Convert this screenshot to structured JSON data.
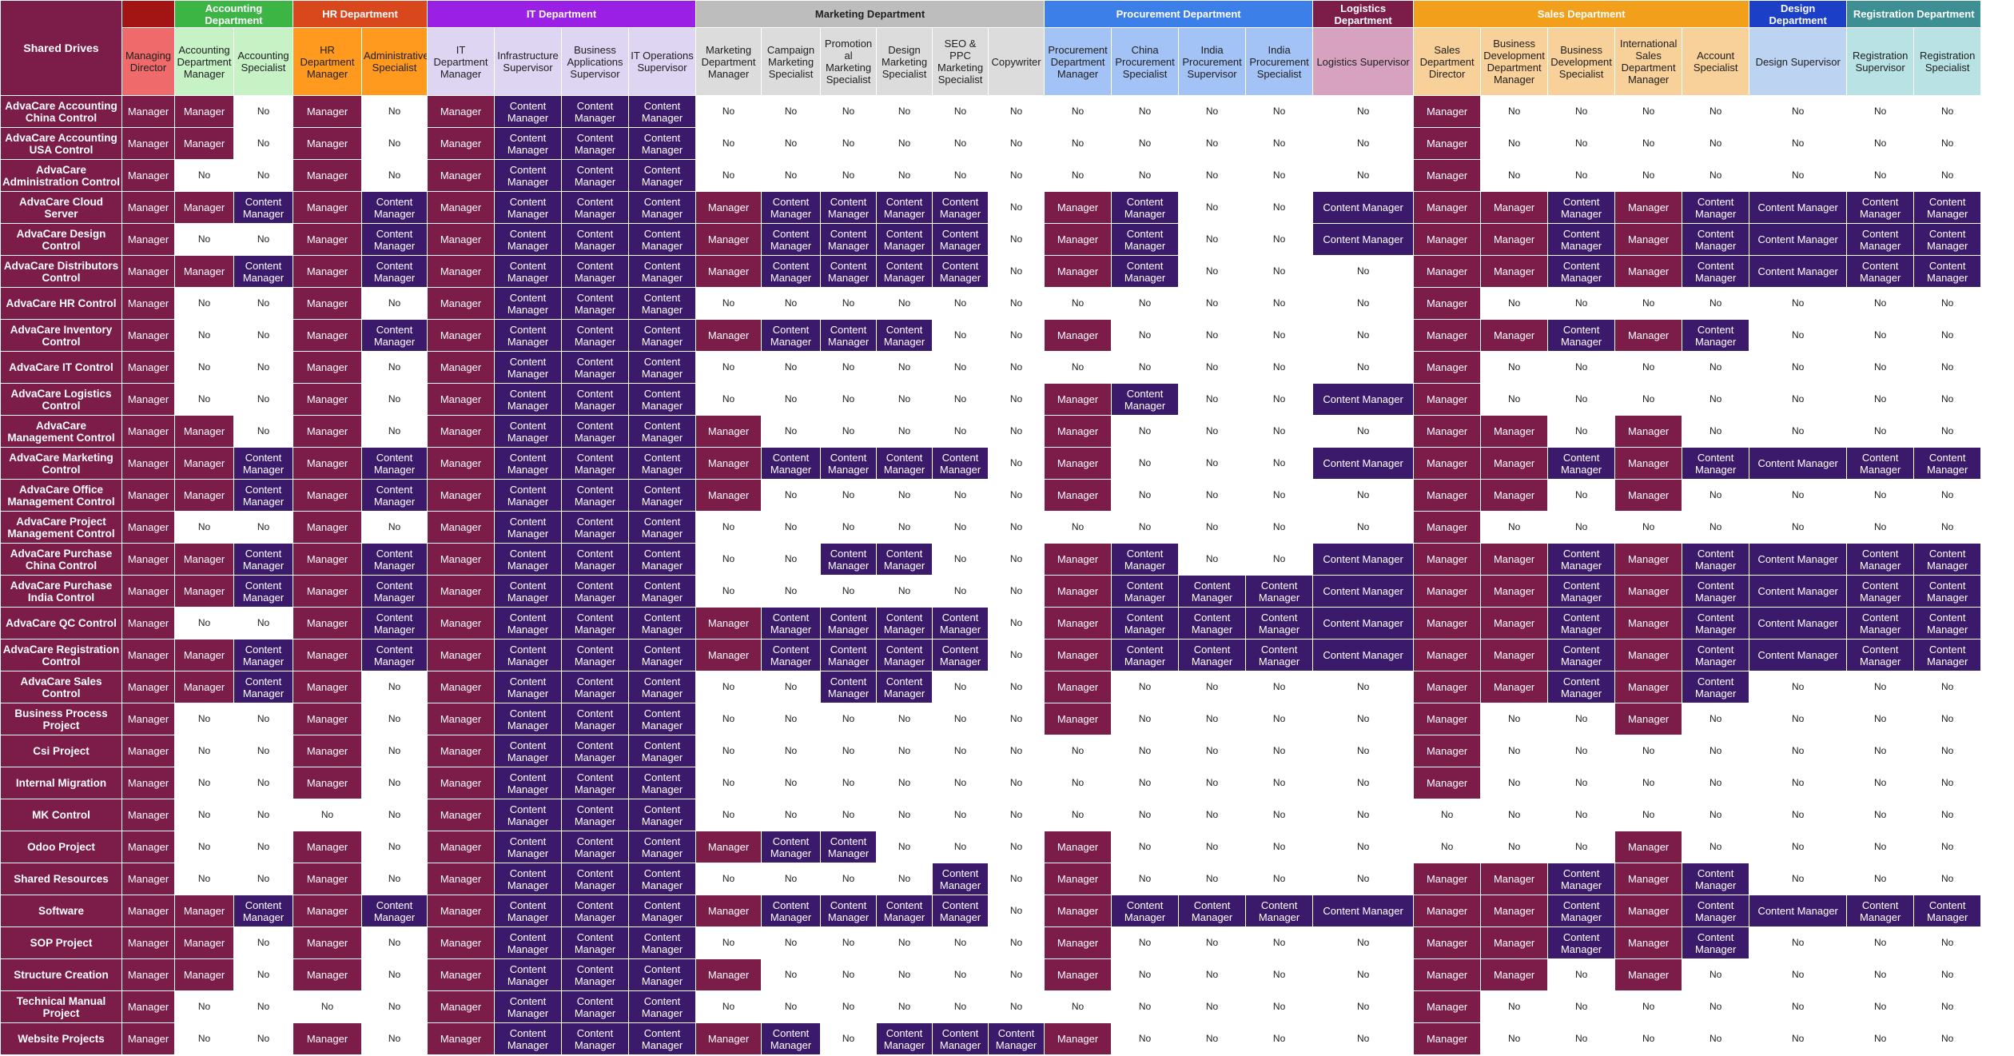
{
  "corner_label": "Shared Drives",
  "colors": {
    "manager": "#7b1c49",
    "content_manager": "#3b1a6b",
    "none": "#ffffff"
  },
  "departments": [
    {
      "name": "",
      "span": 1,
      "color": "#a31515",
      "role_color": "#ef6a6a"
    },
    {
      "name": "Accounting Department",
      "span": 2,
      "color": "#3cb545",
      "role_color": "#c6f2c6"
    },
    {
      "name": "HR Department",
      "span": 2,
      "color": "#d9471c",
      "role_color": "#ff9a1f"
    },
    {
      "name": "IT Department",
      "span": 4,
      "color": "#9a20e6",
      "role_color": "#ddd5f2"
    },
    {
      "name": "Marketing Department",
      "span": 6,
      "color": "#bdbdbd",
      "role_color": "#dcdcdc",
      "dark": true
    },
    {
      "name": "Procurement Department",
      "span": 4,
      "color": "#3d7fe8",
      "role_color": "#a3c2f5"
    },
    {
      "name": "Logistics Department",
      "span": 1,
      "color": "#7b1c49",
      "role_color": "#d6a2c0"
    },
    {
      "name": "Sales Department",
      "span": 5,
      "color": "#f2a01c",
      "role_color": "#f8d09a"
    },
    {
      "name": "Design Department",
      "span": 1,
      "color": "#1c3fc7",
      "role_color": "#bcd4f2"
    },
    {
      "name": "Registration Department",
      "span": 2,
      "color": "#3d8f93",
      "role_color": "#b8e2e4"
    }
  ],
  "roles": [
    "Managing Director",
    "Accounting Department Manager",
    "Accounting Specialist",
    "HR Department Manager",
    "Administrative Specialist",
    "IT Department Manager",
    "Infrastructure Supervisor",
    "Business Applications Supervisor",
    "IT Operations Supervisor",
    "Marketing Department Manager",
    "Campaign Marketing Specialist",
    "Promotion al Marketing Specialist",
    "Design Marketing Specialist",
    "SEO & PPC Marketing Specialist",
    "Copywriter",
    "Procurement Department Manager",
    "China Procurement Specialist",
    "India Procurement Supervisor",
    "India Procurement Specialist",
    "Logistics Supervisor",
    "Sales Department Director",
    "Business Development Department Manager",
    "Business Development Specialist",
    "International Sales Department Manager",
    "Account Specialist",
    "Design Supervisor",
    "Registration Supervisor",
    "Registration Specialist"
  ],
  "labels": {
    "M": "Manager",
    "C": "Content Manager",
    "N": "No"
  },
  "drives": [
    {
      "name": "AdvaCare Accounting China Control",
      "access": "MMNMNMCCCNNNNNNNNNNNMNNNNNNN"
    },
    {
      "name": "AdvaCare Accounting USA Control",
      "access": "MMNMNMCCCNNNNNNNNNNNMNNNNNNN"
    },
    {
      "name": "AdvaCare Administration Control",
      "access": "MNNMNMCCCNNNNNNNNNNNMNNNNNNN"
    },
    {
      "name": "AdvaCare Cloud Server",
      "access": "MMCMCMCCCMCCCCNMCNNCMMCMCCCC"
    },
    {
      "name": "AdvaCare Design Control",
      "access": "MNNMCMCCCMCCCCNMCNNCMMCMCCCC"
    },
    {
      "name": "AdvaCare Distributors Control",
      "access": "MMCMCMCCCMCCCCNMCNNNMMCMCCCC"
    },
    {
      "name": "AdvaCare HR Control",
      "access": "MNNMNMCCCNNNNNNNNNNNMNNNNNNN"
    },
    {
      "name": "AdvaCare Inventory Control",
      "access": "MNNMCMCCCMCCCNNMNNNNMMCMCNNN"
    },
    {
      "name": "AdvaCare IT Control",
      "access": "MNNMNMCCCNNNNNNNNNNNMNNNNNNN"
    },
    {
      "name": "AdvaCare Logistics Control",
      "access": "MNNMNMCCCNNNNNNMCNNCMNNNNNNN"
    },
    {
      "name": "AdvaCare Management Control",
      "access": "MMNMNMCCCMNNNNNMNNNNMMNMNNNN"
    },
    {
      "name": "AdvaCare Marketing Control",
      "access": "MMCMCMCCCMCCCCNMNNNCMMCMCCCC"
    },
    {
      "name": "AdvaCare Office Management Control",
      "access": "MMCMCMCCCMNNNNNMNNNNMMNMNNNN"
    },
    {
      "name": "AdvaCare Project Management Control",
      "access": "MNNMNMCCCNNNNNNNNNNNMNNNNNNN"
    },
    {
      "name": "AdvaCare Purchase China Control",
      "access": "MMCMCMCCCNNCCNNMCNNCMMCMCCCC"
    },
    {
      "name": "AdvaCare Purchase India Control",
      "access": "MMCMCMCCCNNNNNNMCCCCMMCMCCCC"
    },
    {
      "name": "AdvaCare QC Control",
      "access": "MNNMCMCCCMCCCCNMCCCCMMCMCCCC"
    },
    {
      "name": "AdvaCare Registration Control",
      "access": "MMCMCMCCCMCCCCNMCCCCMMCMCCCC"
    },
    {
      "name": "AdvaCare Sales Control",
      "access": "MMCMNMCCCNNCCNNMNNNNMMCMCNNN"
    },
    {
      "name": "Business Process Project",
      "access": "MNNMNMCCCNNNNNNMNNNNMNNMNNNN"
    },
    {
      "name": "Csi Project",
      "access": "MNNMNMCCCNNNNNNNNNNNMNNNNNNN"
    },
    {
      "name": "Internal Migration",
      "access": "MNNMNMCCCNNNNNNNNNNNMNNNNNNN"
    },
    {
      "name": "MK Control",
      "access": "MNNNNMCCCNNNNNNNNNNNNNNNNNNN"
    },
    {
      "name": "Odoo Project",
      "access": "MNNMNMCCCMCCNNNMNNNNNNNMNNNN"
    },
    {
      "name": "Shared Resources",
      "access": "MNNMNMCCCNNNNCNMNNNNMMCMCNNN"
    },
    {
      "name": "Software",
      "access": "MMCMCMCCCMCCCCNMCCCCMMCMCCCC"
    },
    {
      "name": "SOP Project",
      "access": "MMNMNMCCCNNNNNNMNNNNMMCMCNNN"
    },
    {
      "name": "Structure Creation",
      "access": "MMNMNMCCCMNNNNNMNNNNMMNMNNNN"
    },
    {
      "name": "Technical Manual Project",
      "access": "MNNNNMCCCNNNNNNNNNNNMNNNNNNN"
    },
    {
      "name": "Website Projects",
      "access": "MNNMNMCCCMCNCCCMNNNNMNNNNNNN"
    }
  ]
}
